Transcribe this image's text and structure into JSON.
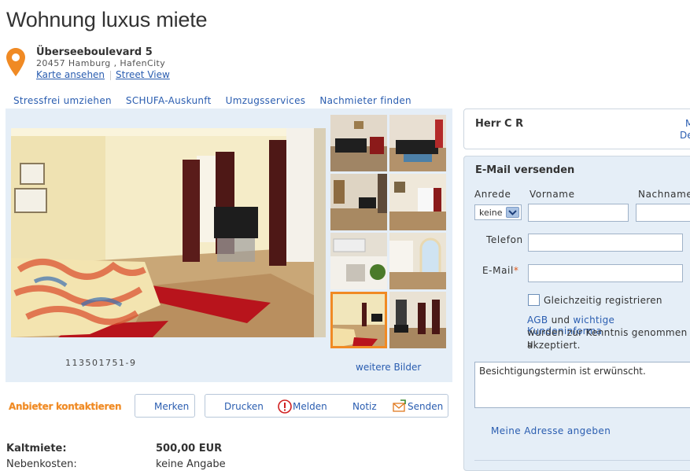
{
  "listing": {
    "title": "Wohnung luxus miete",
    "street": "Überseeboulevard 5",
    "zip_city": "20457 Hamburg , HafenCity",
    "map_link": "Karte ansehen",
    "street_view_link": "Street View"
  },
  "top_nav": [
    "Stressfrei umziehen",
    "SCHUFA-Auskunft",
    "Umzugsservices",
    "Nachmieter finden"
  ],
  "gallery": {
    "object_id": "113501751-9",
    "more_pictures": "weitere Bilder",
    "thumbnails": [
      "living-room",
      "living-room-2",
      "living-tv",
      "dining",
      "kitchen",
      "kitchen-2",
      "bedroom-selected",
      "hallway"
    ]
  },
  "actions": {
    "contact": "Anbieter kontaktieren",
    "save": "Merken",
    "print": "Drucken",
    "report": "Melden",
    "note": "Notiz",
    "send": "Senden"
  },
  "prices": [
    {
      "label": "Kaltmiete:",
      "value": "500,00 EUR"
    },
    {
      "label": "Nebenkosten:",
      "value": "keine Angabe"
    }
  ],
  "agent": {
    "name": "Herr C R",
    "cut_1": "M",
    "cut_2": "De"
  },
  "form": {
    "title": "E-Mail versenden",
    "salutation_label": "Anrede",
    "salutation_value": "keine",
    "firstname_label": "Vorname",
    "lastname_label": "Nachname",
    "phone_label": "Telefon",
    "email_label": "E-Mail",
    "required_mark": "*",
    "register_label": "Gleichzeitig registrieren",
    "agb_link": "AGB",
    "agb_and": "und",
    "info_link": "wichtige Kundeninforma",
    "agb_line2": "wurden zur Kenntnis genommen u",
    "agb_line3": "akzeptiert.",
    "message": "Besichtigungstermin ist erwünscht.",
    "address_link": "Meine Adresse angeben"
  },
  "colors": {
    "accent": "#f08a24",
    "link": "#2a5db0",
    "panel": "#e5eef7"
  }
}
